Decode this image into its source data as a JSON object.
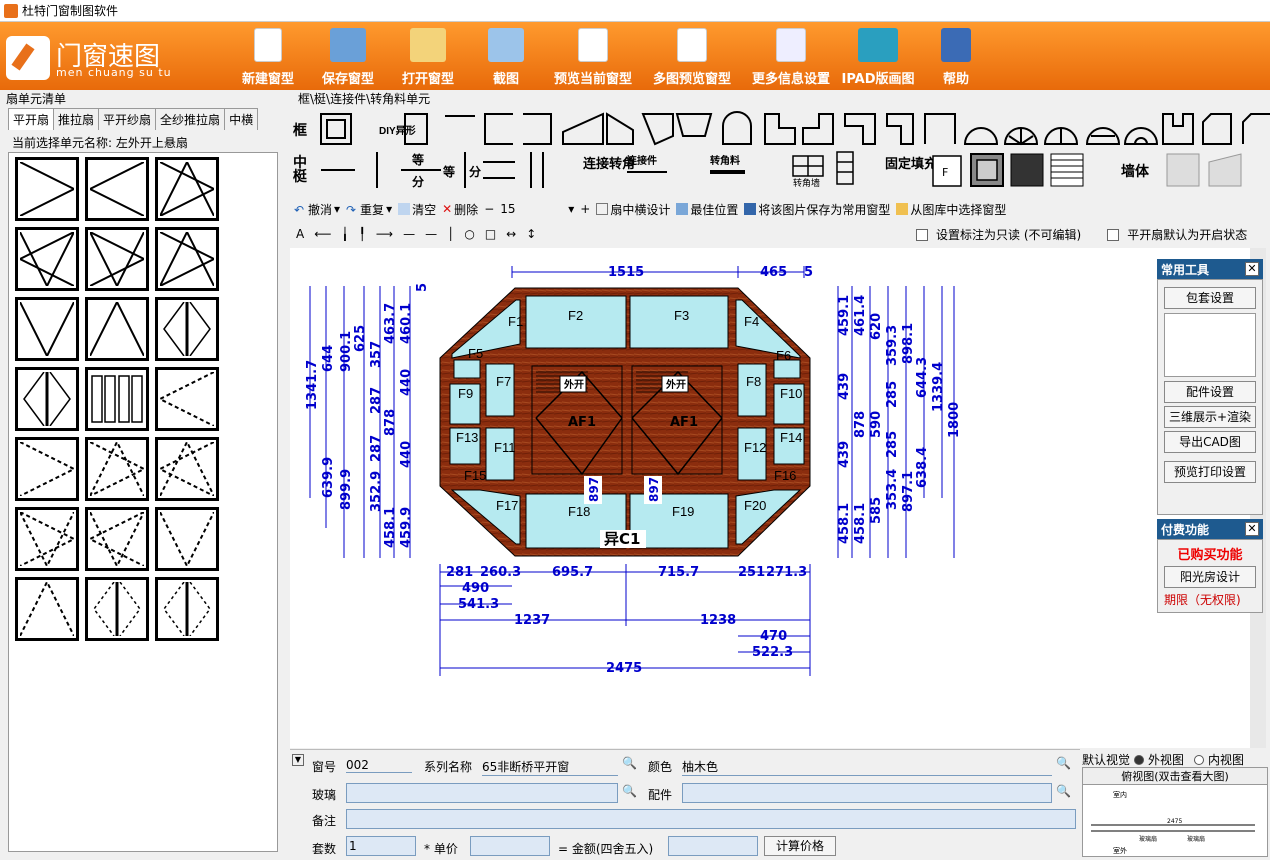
{
  "window": {
    "title": "杜特门窗制图软件"
  },
  "logo": {
    "cn": "门窗速图",
    "en": "men chuang su tu"
  },
  "toolbar": [
    {
      "label": "新建窗型"
    },
    {
      "label": "保存窗型"
    },
    {
      "label": "打开窗型"
    },
    {
      "label": "截图"
    },
    {
      "label": "预览当前窗型"
    },
    {
      "label": "多图预览窗型"
    },
    {
      "label": "更多信息设置"
    },
    {
      "label": "IPAD版画图"
    },
    {
      "label": "帮助"
    }
  ],
  "left": {
    "title": "扇单元清单",
    "tabs": [
      "平开扇",
      "推拉扇",
      "平开纱扇",
      "全纱推拉扇",
      "中横"
    ],
    "current": "当前选择单元名称: 左外开上悬扇"
  },
  "palette": {
    "title": "框\\梃\\连接件\\转角料单元",
    "row1_label": "框",
    "row2_label": "中梃",
    "diy": "DIY异形",
    "deng": "等",
    "fen": "分",
    "lianjie": "连接转角",
    "lianjiejian": "连接件",
    "zhuanjiaoliao": "转角料",
    "zhuanjiaoqiang": "转角墙",
    "guding": "固定填充",
    "qiangti": "墙体",
    "f_label": "F"
  },
  "commands": {
    "undo": "撤消",
    "redo": "重复",
    "clear": "清空",
    "delete": "删除",
    "font_size": "15",
    "mid_design": "扇中横设计",
    "best_pos": "最佳位置",
    "save_common": "将该图片保存为常用窗型",
    "from_lib": "从图库中选择窗型"
  },
  "options": {
    "readonly": "设置标注为只读 (不可编辑)",
    "open_default": "平开扇默认为开启状态"
  },
  "drawing": {
    "top": [
      "1515",
      "465",
      "5"
    ],
    "bottom": [
      "281",
      "260.3",
      "695.7",
      "715.7",
      "251",
      "271.3",
      "490",
      "541.3",
      "1237",
      "1238",
      "470",
      "522.3",
      "2475"
    ],
    "left": [
      "1341.7",
      "644",
      "900.1",
      "625",
      "357",
      "463.7",
      "460.1",
      "5",
      "287",
      "878",
      "440",
      "287",
      "639.9",
      "899.9",
      "352.9",
      "458.1",
      "459.9",
      "440"
    ],
    "right": [
      "459.1",
      "461.4",
      "620",
      "359.3",
      "898.1",
      "644.3",
      "1339.4",
      "439",
      "878",
      "590",
      "285",
      "1800",
      "439",
      "285",
      "353.4",
      "638.4",
      "458.1",
      "458.1",
      "585",
      "897.1"
    ],
    "panes": [
      "F1",
      "F2",
      "F3",
      "F4",
      "F5",
      "F6",
      "F7",
      "F8",
      "F9",
      "F10",
      "F11",
      "F12",
      "F13",
      "F14",
      "F15",
      "F16",
      "F17",
      "F18",
      "F19",
      "F20"
    ],
    "sash": [
      "外开",
      "外开",
      "AF1",
      "AF1"
    ],
    "mid": [
      "897",
      "897"
    ],
    "code": "异C1"
  },
  "common_tools": {
    "title": "常用工具",
    "btns": [
      "包套设置",
      "配件设置",
      "三维展示+渲染",
      "导出CAD图",
      "预览打印设置"
    ]
  },
  "paid": {
    "title": "付费功能",
    "bought": "已购买功能",
    "sun": "阳光房设计",
    "period": "期限（无权限)"
  },
  "form": {
    "window_no_label": "窗号",
    "window_no": "002",
    "series_label": "系列名称",
    "series": "65非断桥平开窗",
    "color_label": "颜色",
    "color": "柚木色",
    "glass_label": "玻璃",
    "fitting_label": "配件",
    "remark_label": "备注",
    "sets_label": "套数",
    "sets": "1",
    "unit_label": "* 单价",
    "amount_label": "= 金额(四舍五入)",
    "calc": "计算价格"
  },
  "view": {
    "default": "默认视觉",
    "outer": "外视图",
    "inner": "内视图",
    "top": "俯视图(双击查看大图)",
    "indoor": "室内",
    "outdoor": "室外",
    "glass": "玻璃扇",
    "dim": "2475"
  }
}
